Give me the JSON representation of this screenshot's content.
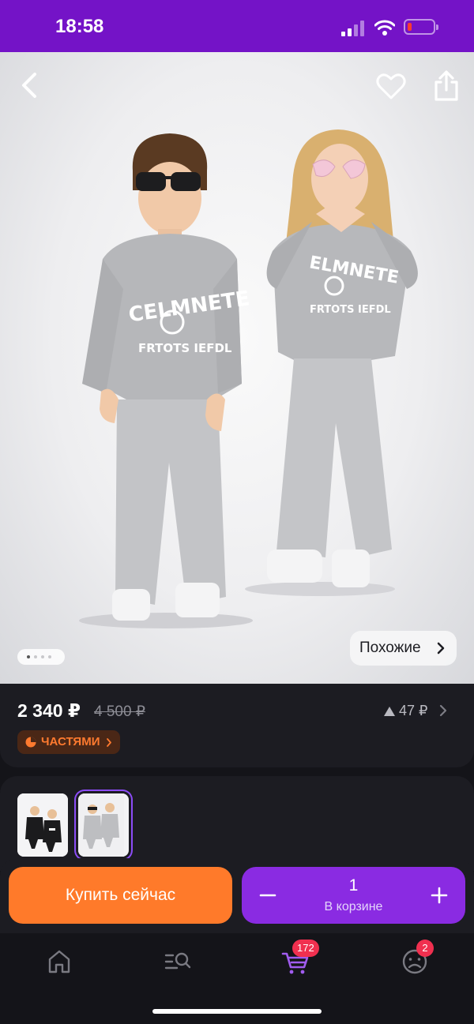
{
  "status_bar": {
    "time": "18:58"
  },
  "product": {
    "pager": {
      "count": 4,
      "active": 0
    },
    "similar_label": "Похожие"
  },
  "price": {
    "current": "2 340 ₽",
    "old": "4 500 ₽",
    "delta": "47 ₽",
    "parts_label": "ЧАСТЯМИ"
  },
  "variants": [
    {
      "name": "black-set",
      "selected": false
    },
    {
      "name": "grey-set",
      "selected": true
    }
  ],
  "actions": {
    "buy_now_label": "Купить сейчас",
    "cart_quantity": "1",
    "cart_caption": "В корзине"
  },
  "tab_bar": {
    "items": [
      {
        "icon": "home-icon"
      },
      {
        "icon": "catalog-search-icon"
      },
      {
        "icon": "cart-icon",
        "badge": "172"
      },
      {
        "icon": "profile-icon",
        "badge": "2"
      }
    ]
  },
  "colors": {
    "status_bar": "#7413c7",
    "accent_orange": "#ff7a2a",
    "accent_purple": "#8a2be2",
    "badge_red": "#f0304f"
  }
}
